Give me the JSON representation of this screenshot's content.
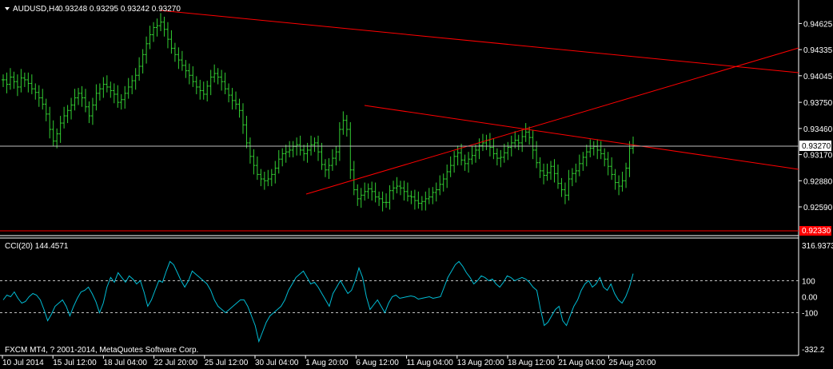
{
  "chart_title": "AUDUSD,H4",
  "ohlc_header": "0.93248 0.93295 0.93242 0.93270",
  "indicator_title": "CCI(20) 144.4571",
  "copyright": "FXCM MT4, ? 2001-2014, MetaQuotes Software Corp.",
  "current_price": "0.93270",
  "bottom_level": "0.92330",
  "colors": {
    "background": "#000000",
    "axis": "#ffffff",
    "candle": "#32cd32",
    "trendline": "#ff0000",
    "cci_line": "#00bcd4",
    "price_label_bg": "#ffffff",
    "level_label_bg": "#ff0000"
  },
  "chart_data": [
    {
      "type": "line",
      "title": "AUDUSD,H4",
      "price_ticks": [
        "0.94625",
        "0.94335",
        "0.94045",
        "0.93750",
        "0.93460",
        "0.93170",
        "0.92880",
        "0.92590"
      ],
      "price_tick_values": [
        0.94625,
        0.94335,
        0.94045,
        0.9375,
        0.9346,
        0.9317,
        0.9288,
        0.9259
      ],
      "ylim": [
        0.9228,
        0.9485
      ],
      "time_ticks": [
        "10 Jul 2014",
        "15 Jul 12:00",
        "18 Jul 04:00",
        "22 Jul 20:00",
        "25 Jul 12:00",
        "30 Jul 04:00",
        "1 Aug 20:00",
        "6 Aug 12:00",
        "11 Aug 04:00",
        "13 Aug 20:00",
        "18 Aug 12:00",
        "21 Aug 04:00",
        "25 Aug 20:00"
      ],
      "close_series": [
        0.94,
        0.9395,
        0.9403,
        0.9398,
        0.9392,
        0.9402,
        0.94,
        0.9396,
        0.939,
        0.9386,
        0.938,
        0.9373,
        0.9362,
        0.9345,
        0.9332,
        0.934,
        0.9352,
        0.936,
        0.9366,
        0.9372,
        0.938,
        0.9385,
        0.938,
        0.937,
        0.936,
        0.9372,
        0.9385,
        0.939,
        0.9395,
        0.9392,
        0.9388,
        0.9384,
        0.9375,
        0.9378,
        0.9385,
        0.9392,
        0.9399,
        0.9405,
        0.9415,
        0.9428,
        0.944,
        0.945,
        0.9458,
        0.946,
        0.9464,
        0.9456,
        0.9445,
        0.9435,
        0.9428,
        0.9422,
        0.9416,
        0.941,
        0.9405,
        0.9398,
        0.9392,
        0.9388,
        0.9384,
        0.9393,
        0.9403,
        0.9407,
        0.9403,
        0.9398,
        0.939,
        0.9383,
        0.9377,
        0.9373,
        0.9366,
        0.935,
        0.933,
        0.9315,
        0.9305,
        0.9295,
        0.929,
        0.9288,
        0.929,
        0.9295,
        0.9302,
        0.9312,
        0.9318,
        0.932,
        0.9322,
        0.9326,
        0.9328,
        0.9322,
        0.9318,
        0.9322,
        0.9328,
        0.933,
        0.932,
        0.9306,
        0.93,
        0.9305,
        0.9313,
        0.932,
        0.9345,
        0.9355,
        0.9345,
        0.93,
        0.9278,
        0.9268,
        0.9272,
        0.9276,
        0.9279,
        0.9276,
        0.927,
        0.9268,
        0.9264,
        0.9264,
        0.9277,
        0.928,
        0.9282,
        0.928,
        0.9276,
        0.9271,
        0.927,
        0.9266,
        0.9263,
        0.9265,
        0.9268,
        0.927,
        0.9275,
        0.9278,
        0.9284,
        0.929,
        0.9298,
        0.9305,
        0.9315,
        0.9319,
        0.9311,
        0.9307,
        0.9312,
        0.9316,
        0.9322,
        0.9327,
        0.933,
        0.9333,
        0.9325,
        0.9318,
        0.9313,
        0.9314,
        0.9319,
        0.9325,
        0.933,
        0.9333,
        0.933,
        0.9337,
        0.9342,
        0.9336,
        0.9322,
        0.9308,
        0.9299,
        0.9294,
        0.9297,
        0.9304,
        0.9296,
        0.9285,
        0.9278,
        0.9272,
        0.929,
        0.9296,
        0.9299,
        0.9307,
        0.9314,
        0.932,
        0.9324,
        0.9326,
        0.9322,
        0.9318,
        0.9312,
        0.9304,
        0.9295,
        0.9286,
        0.9282,
        0.9288,
        0.9302,
        0.9324,
        0.9327
      ]
    },
    {
      "type": "line",
      "title": "CCI(20) 144.4571",
      "ticks": [
        "316.9373",
        "100",
        "0.00",
        "-100",
        "-332.2"
      ],
      "tick_values": [
        316.9373,
        100,
        0,
        -100,
        -332.2
      ],
      "ylim": [
        -332.2,
        316.9373
      ],
      "levels": [
        100,
        -100
      ],
      "series": [
        {
          "values": [
            -20,
            10,
            0,
            30,
            -10,
            -40,
            -30,
            0,
            20,
            10,
            -20,
            -80,
            -150,
            -110,
            -60,
            -40,
            -20,
            -60,
            -120,
            -60,
            -10,
            30,
            40,
            60,
            20,
            -30,
            -100,
            -40,
            60,
            120,
            90,
            150,
            120,
            90,
            130,
            110,
            80,
            100,
            30,
            -60,
            -20,
            40,
            100,
            90,
            160,
            220,
            200,
            150,
            100,
            60,
            100,
            160,
            140,
            120,
            100,
            80,
            40,
            -20,
            -60,
            -80,
            -100,
            -80,
            -60,
            -40,
            -20,
            -20,
            -60,
            -120,
            -180,
            -280,
            -220,
            -160,
            -120,
            -100,
            -80,
            -60,
            -20,
            40,
            80,
            120,
            140,
            160,
            120,
            80,
            90,
            60,
            20,
            -20,
            -60,
            20,
            60,
            100,
            60,
            20,
            40,
            100,
            180,
            120,
            0,
            -80,
            -50,
            -20,
            -60,
            -100,
            -40,
            0,
            10,
            -10,
            -5,
            0,
            5,
            0,
            -15,
            -10,
            -5,
            0,
            -10,
            -5,
            0,
            60,
            120,
            160,
            200,
            220,
            190,
            150,
            120,
            80,
            100,
            130,
            120,
            100,
            110,
            80,
            60,
            90,
            130,
            120,
            100,
            110,
            120,
            110,
            90,
            60,
            40,
            -80,
            -180,
            -160,
            -120,
            -80,
            -60,
            -150,
            -180,
            -120,
            -60,
            -20,
            40,
            80,
            100,
            60,
            80,
            120,
            60,
            40,
            80,
            20,
            -20,
            -40,
            0,
            60,
            144
          ]
        }
      ]
    }
  ]
}
